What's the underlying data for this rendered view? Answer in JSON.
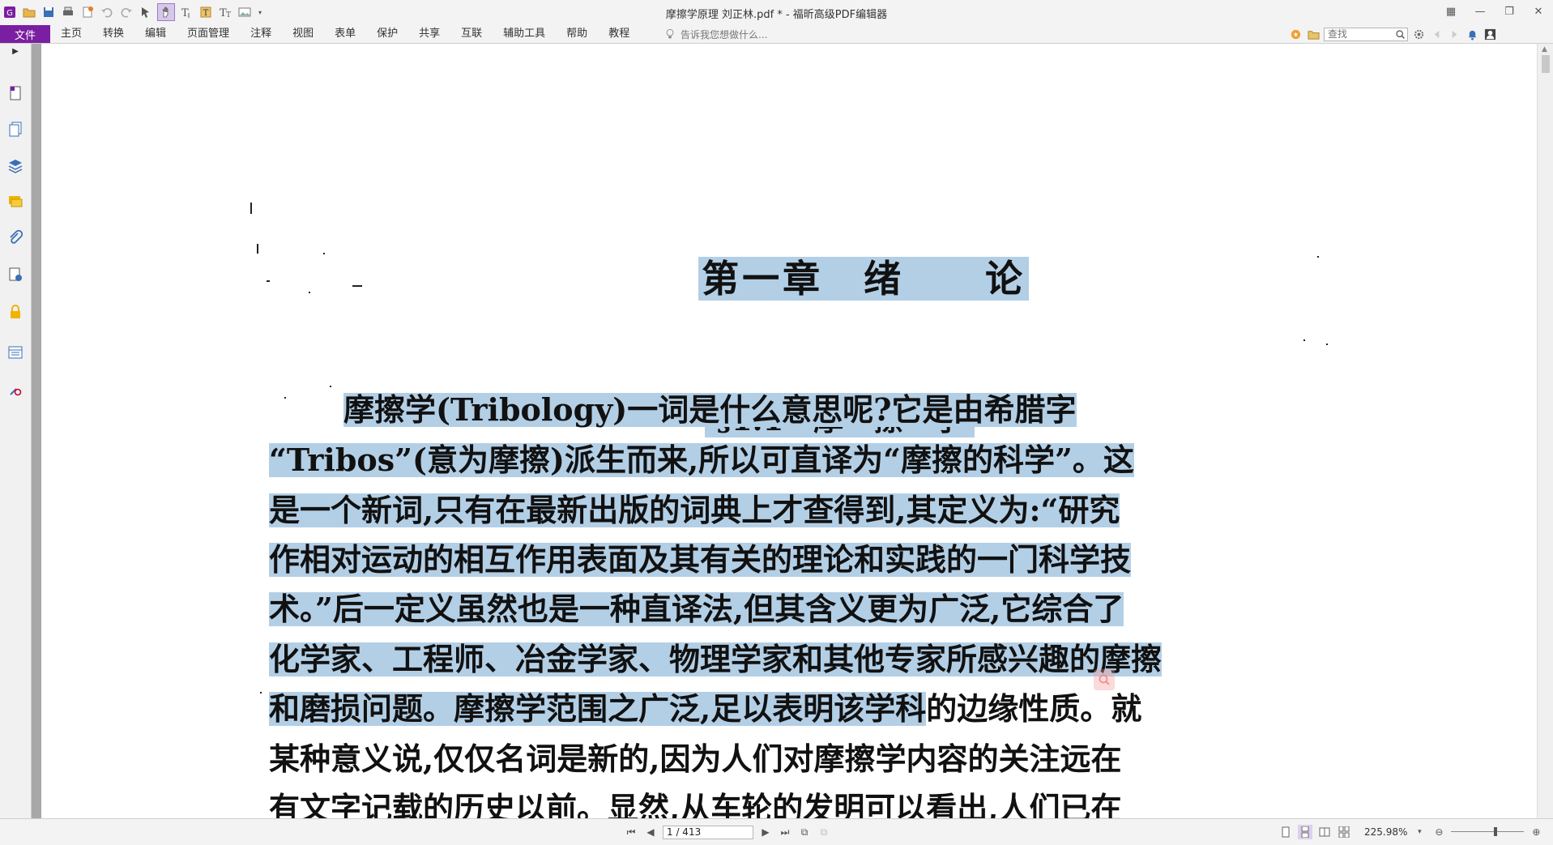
{
  "window": {
    "title": "摩擦学原理 刘正林.pdf * - 福昕高级PDF编辑器"
  },
  "quick_access": {
    "icons": [
      "app-logo-icon",
      "open-icon",
      "save-icon",
      "print-icon",
      "new-icon",
      "undo-icon",
      "redo-icon",
      "select-tool-icon",
      "hand-tool-icon",
      "text-select-icon",
      "typewriter-icon",
      "text-icon",
      "image-icon",
      "more-dropdown-icon"
    ]
  },
  "ribbon": {
    "file_tab": "文件",
    "tabs": [
      "主页",
      "转换",
      "编辑",
      "页面管理",
      "注释",
      "视图",
      "表单",
      "保护",
      "共享",
      "互联",
      "辅助工具",
      "帮助",
      "教程"
    ],
    "tell_me": "告诉我您想做什么...",
    "search_placeholder": "查找"
  },
  "document": {
    "chapter_title": "第一章　绪　　论",
    "section_title": "§1.1　摩　擦　学",
    "lines": [
      {
        "text": "摩擦学(Tribology)一词是什么意思呢?它是由希腊字",
        "highlight": "full"
      },
      {
        "text": "“Tribos”(意为摩擦)派生而来,所以可直译为“摩擦的科学”。这",
        "highlight": "full"
      },
      {
        "text": "是一个新词,只有在最新出版的词典上才查得到,其定义为:“研究",
        "highlight": "full"
      },
      {
        "text": "作相对运动的相互作用表面及其有关的理论和实践的一门科学技",
        "highlight": "full"
      },
      {
        "text": "术。”后一定义虽然也是一种直译法,但其含义更为广泛,它综合了",
        "highlight": "full"
      },
      {
        "text": "化学家、工程师、冶金学家、物理学家和其他专家所感兴趣的摩擦",
        "highlight": "full"
      },
      {
        "text_highlighted": "和磨损问题。摩擦学范围之广泛,足以表明该学科",
        "text_plain": "的边缘性质。就",
        "highlight": "partial"
      },
      {
        "text": "某种意义说,仅仅名词是新的,因为人们对摩擦学内容的关注远在",
        "highlight": "none"
      },
      {
        "text": "有文字记载的历史以前。显然,从车轮的发明可以看出,人们已在",
        "highlight": "none"
      }
    ]
  },
  "statusbar": {
    "page_value": "1 / 413",
    "zoom": "225.98%",
    "zoom_fraction": 0.62
  }
}
